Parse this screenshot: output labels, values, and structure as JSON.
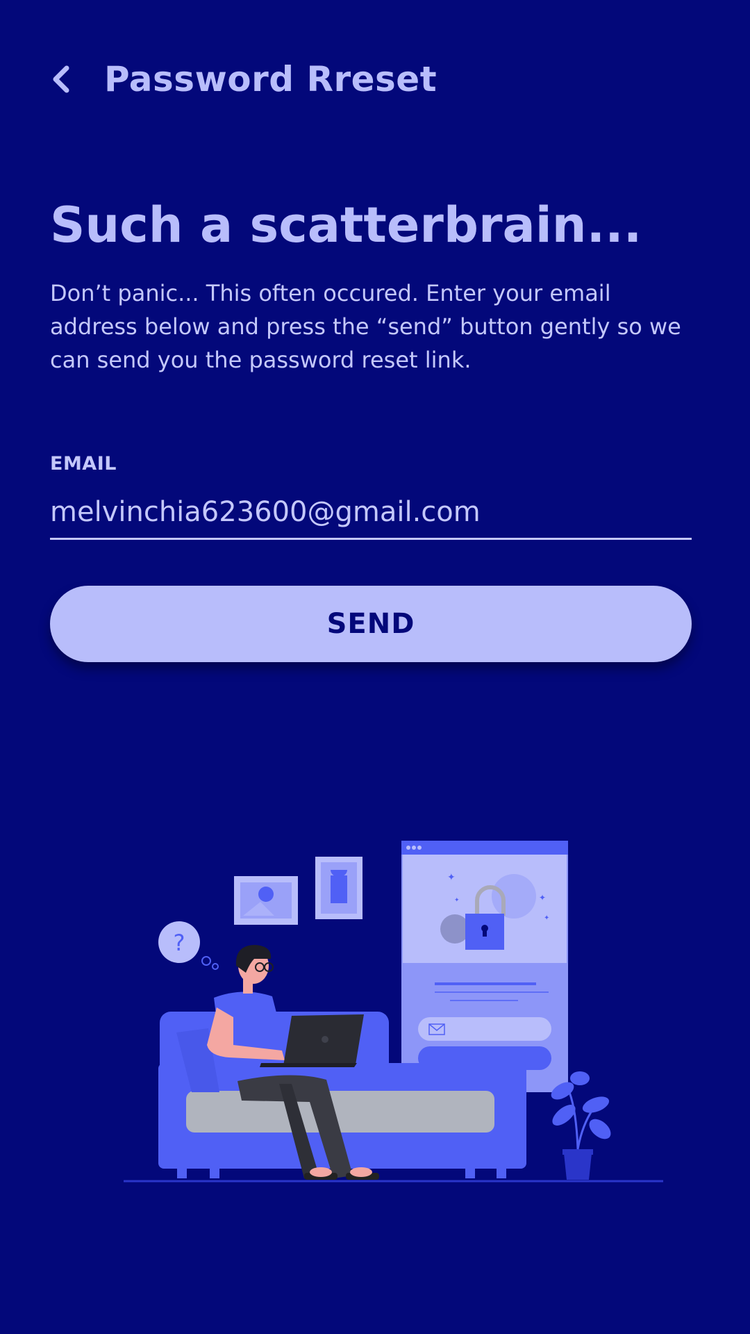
{
  "header": {
    "title": "Password Rreset"
  },
  "main": {
    "headline": "Such a scatterbrain...",
    "description": "Don’t panic... This often occured. Enter your email address below and press the “send” button gently so we can send you the password reset link.",
    "email_label": "EMAIL",
    "email_value": "melvinchia623600@gmail.com",
    "send_label": "SEND"
  },
  "colors": {
    "background": "#03087a",
    "accent_light": "#b8bdfb",
    "accent_blue": "#5060f5"
  },
  "icons": {
    "back": "chevron-left-icon",
    "question": "question-mark-icon",
    "lock": "padlock-icon",
    "mail": "envelope-icon"
  }
}
